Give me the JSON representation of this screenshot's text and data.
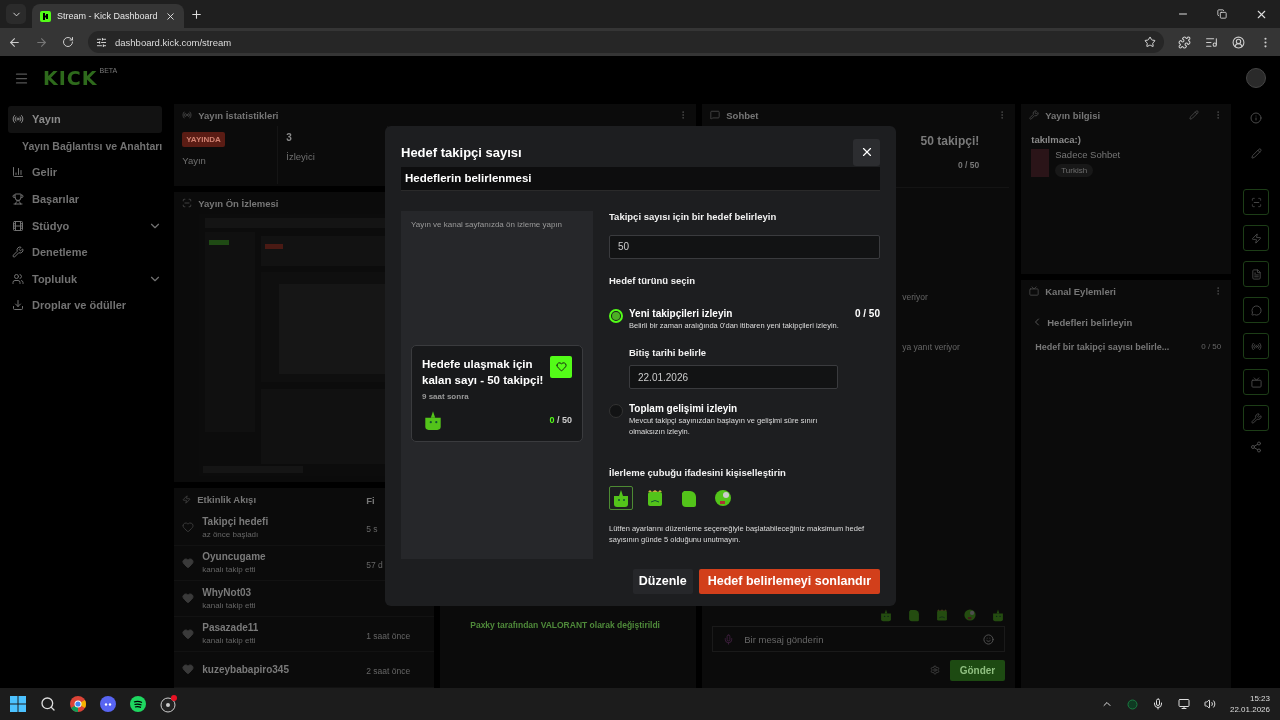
{
  "browser": {
    "tab_title": "Stream - Kick Dashboard",
    "url": "dashboard.kick.com/stream"
  },
  "app": {
    "logo": "KICK",
    "logo_badge": "BETA"
  },
  "sidebar": {
    "items": [
      {
        "label": "Yayın",
        "selected": true,
        "kind": "item"
      },
      {
        "label": "Yayın Bağlantısı ve Anahtarı",
        "selected": false,
        "kind": "sub"
      },
      {
        "label": "Gelir",
        "selected": false,
        "kind": "item"
      },
      {
        "label": "Başarılar",
        "selected": false,
        "kind": "item"
      },
      {
        "label": "Stüdyo",
        "selected": false,
        "kind": "group"
      },
      {
        "label": "Denetleme",
        "selected": false,
        "kind": "item"
      },
      {
        "label": "Topluluk",
        "selected": false,
        "kind": "group"
      },
      {
        "label": "Droplar ve ödüller",
        "selected": false,
        "kind": "item"
      }
    ]
  },
  "stats": {
    "title": "Yayın İstatistikleri",
    "status_badge": "YAYINDA",
    "status_label": "Yayın",
    "viewers": "3",
    "viewers_label": "İzleyici"
  },
  "preview": {
    "title": "Yayın Ön İzlemesi",
    "kind": "picture"
  },
  "activity": {
    "title": "Etkinlik Akışı",
    "filter": "Fi",
    "events": [
      {
        "name": "Takipçi hedefi",
        "detail": "az önce başladı",
        "time": "5 s",
        "kind": "goal"
      },
      {
        "name": "Oyuncugame",
        "detail": "kanalı takip etti",
        "time": "57 d",
        "kind": "follow"
      },
      {
        "name": "WhyNot03",
        "detail": "kanalı takip etti",
        "kind": "follow"
      },
      {
        "name": "Pasazade11",
        "detail": "kanalı takip etti",
        "time": "1 saat önce",
        "kind": "follow"
      },
      {
        "name": "kuzeybabapiro345",
        "time": "2 saat önce",
        "kind": "follow"
      }
    ]
  },
  "middle": {
    "status_line": "Paxky tarafından VALORANT olarak değiştirildi"
  },
  "chat": {
    "title": "Sohbet",
    "goal_text": "50 takipçi!",
    "goal_count": "0 / 50",
    "messages": [
      "veriyor",
      "ya yanıt veriyor"
    ],
    "placeholder": "Bir mesaj gönderin",
    "send": "Gönder"
  },
  "stream_info": {
    "title": "Yayın bilgisi",
    "stream_title": "takılmaca:)",
    "category": "Sadece Sohbet",
    "tag": "Turkish"
  },
  "channel_actions": {
    "title": "Kanal Eylemleri",
    "back": "Hedefleri belirleyin",
    "goal_text": "Hedef bir takipçi sayısı belirle...",
    "goal_count": "0 / 50"
  },
  "modal": {
    "title": "Hedef takipçi sayısı",
    "section": "Hedeflerin belirlenmesi",
    "preview_hint": "Yayın ve kanal sayfanızda ön izleme yapın",
    "preview_card": {
      "title": "Hedefe ulaşmak için kalan sayı - 50 takipçi!",
      "subtitle": "9 saat sonra",
      "current": "0",
      "total": "/ 50"
    },
    "target_label": "Takipçi sayısı için bir hedef belirleyin",
    "target_value": "50",
    "type_label": "Hedef türünü seçin",
    "options": [
      {
        "title": "Yeni takipçileri izleyin",
        "description": "Belirli bir zaman aralığında 0'dan itibaren yeni takipçileri izleyin.",
        "selected": true,
        "count": "0 / 50",
        "end_date_label": "Bitiş tarihi belirle",
        "end_date": "22.01.2026"
      },
      {
        "title": "Toplam gelişimi izleyin",
        "description": "Mevcut takipçi sayınızdan başlayın ve gelişimi süre sınırı olmaksızın izleyin.",
        "selected": false
      }
    ],
    "emote_label": "İlerleme çubuğu ifadesini kişiselleştirin",
    "emotes": [
      {
        "selected": true
      },
      {
        "selected": false
      },
      {
        "selected": false
      },
      {
        "selected": false
      }
    ],
    "note": "Lütfen ayarlarını düzenleme seçeneğiyle başlatabileceğiniz maksimum hedef sayısının günde 5 olduğunu unutmayın.",
    "edit_button": "Düzenle",
    "finish_button": "Hedef belirlemeyi sonlandır"
  },
  "taskbar": {
    "time": "15:23",
    "date": "22.01.2026"
  }
}
